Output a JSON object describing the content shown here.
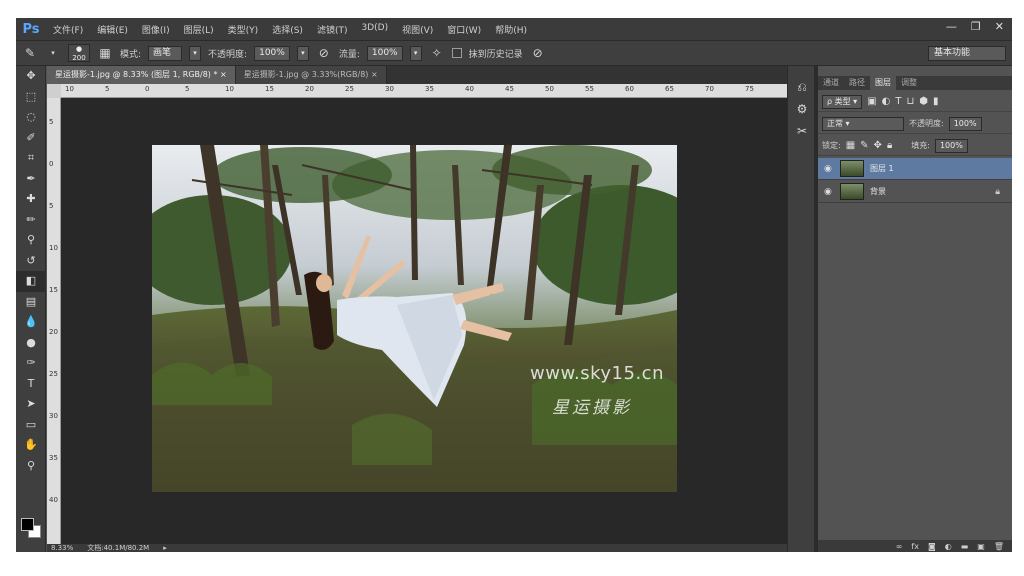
{
  "app": {
    "logo": "Ps"
  },
  "menu": [
    "文件(F)",
    "编辑(E)",
    "图像(I)",
    "图层(L)",
    "类型(Y)",
    "选择(S)",
    "滤镜(T)",
    "3D(D)",
    "视图(V)",
    "窗口(W)",
    "帮助(H)"
  ],
  "window_controls": [
    "—",
    "❐",
    "✕"
  ],
  "options": {
    "tool_icon": "eraser-icon",
    "brush_size": "200",
    "mode_label": "模式:",
    "mode_value": "画笔",
    "opacity_label": "不透明度:",
    "opacity_value": "100%",
    "flow_label": "流量:",
    "flow_value": "100%",
    "history_label": "抹到历史记录",
    "workspace": "基本功能"
  },
  "doc_tabs": [
    {
      "label": "星运摄影-1.jpg @ 8.33% (图层 1, RGB/8) * ×",
      "active": true
    },
    {
      "label": "星运摄影-1.jpg @ 3.33%(RGB/8) ×",
      "active": false
    }
  ],
  "ruler_top_labels": [
    "10",
    "5",
    "0",
    "5",
    "10",
    "15",
    "20",
    "25",
    "30",
    "35",
    "40",
    "45",
    "50",
    "55",
    "60",
    "65",
    "70",
    "75"
  ],
  "ruler_left_labels": [
    "5",
    "0",
    "5",
    "10",
    "15",
    "20",
    "25",
    "30",
    "35",
    "40"
  ],
  "watermark": {
    "url": "www.sky15.cn",
    "name": "星运摄影"
  },
  "status": {
    "zoom": "8.33%",
    "doc": "文档:40.1M/80.2M"
  },
  "layers_panel": {
    "tabs": [
      "通道",
      "路径",
      "图层",
      "调整"
    ],
    "active_tab": 2,
    "filter_kind": "类型",
    "blend_mode": "正常",
    "opacity_label": "不透明度:",
    "opacity_value": "100%",
    "lock_label": "锁定:",
    "fill_label": "填充:",
    "fill_value": "100%",
    "layers": [
      {
        "name": "图层 1",
        "selected": true,
        "locked": false
      },
      {
        "name": "背景",
        "selected": false,
        "locked": true
      }
    ]
  }
}
